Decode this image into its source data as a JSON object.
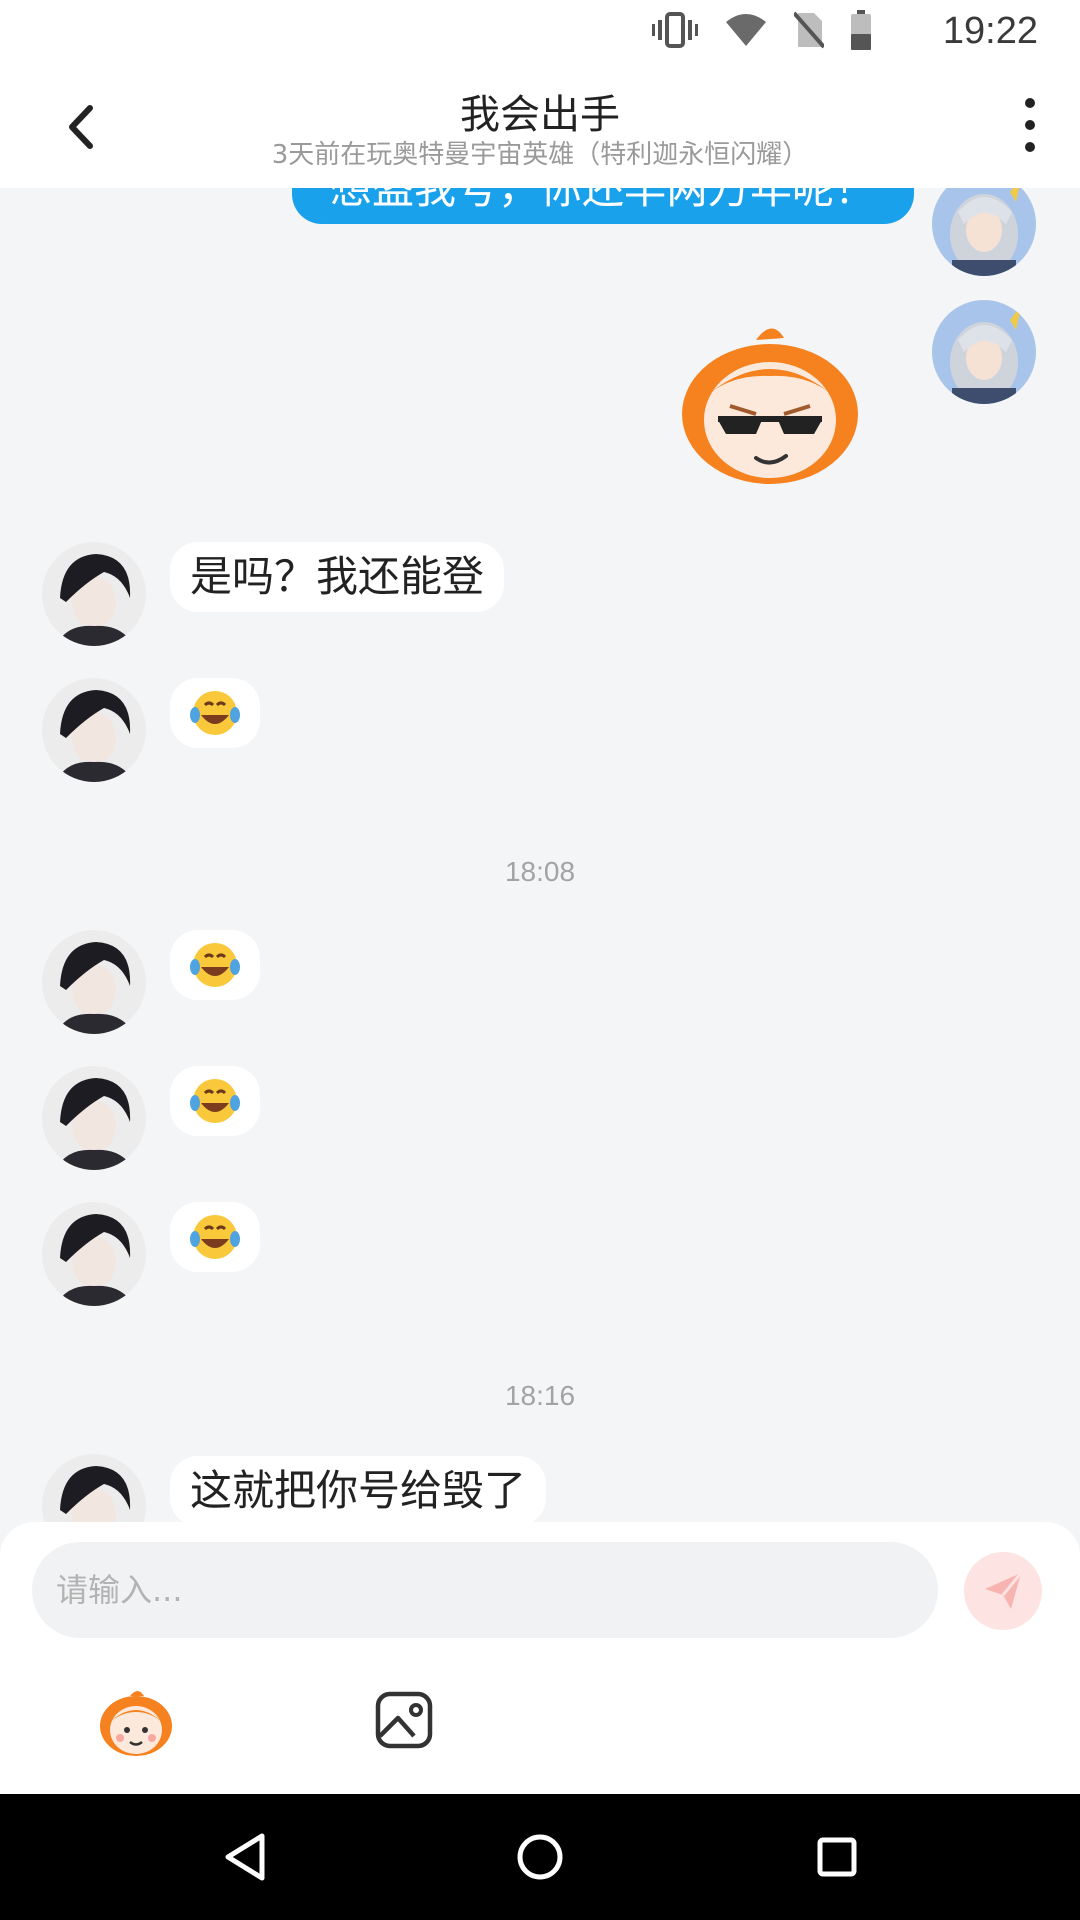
{
  "status_bar": {
    "time": "19:22",
    "icons": [
      "vibrate-icon",
      "wifi-icon",
      "no-sim-icon",
      "battery-icon"
    ]
  },
  "header": {
    "title": "我会出手",
    "subtitle": "3天前在玩奥特曼宇宙英雄（特利迦永恒闪耀）",
    "back_icon": "back-arrow-icon",
    "menu_icon": "more-vertical-icon"
  },
  "messages": [
    {
      "side": "right",
      "type": "text",
      "text": "想盗我号，你还早两万年呢！"
    },
    {
      "side": "right",
      "type": "sticker",
      "sticker": "sunglasses-mascot-sticker"
    },
    {
      "side": "left",
      "type": "text",
      "text": "是吗？我还能登"
    },
    {
      "side": "left",
      "type": "emoji",
      "emoji": "😂"
    },
    {
      "side": "center",
      "type": "timestamp",
      "text": "18:08"
    },
    {
      "side": "left",
      "type": "emoji",
      "emoji": "😂"
    },
    {
      "side": "left",
      "type": "emoji",
      "emoji": "😂"
    },
    {
      "side": "left",
      "type": "emoji",
      "emoji": "😂"
    },
    {
      "side": "center",
      "type": "timestamp",
      "text": "18:16"
    },
    {
      "side": "left",
      "type": "text",
      "text": "这就把你号给毁了"
    }
  ],
  "composer": {
    "placeholder": "请输入...",
    "send_icon": "send-icon",
    "tools": [
      "sticker-mascot-icon",
      "image-icon"
    ]
  },
  "nav_bar": [
    "back-triangle-icon",
    "home-circle-icon",
    "recents-square-icon"
  ],
  "colors": {
    "accent": "#1aa1ec",
    "background": "#f4f5f7",
    "send_disabled": "#fde3e2",
    "send_arrow": "#f08a86",
    "mascot_orange": "#f5821f"
  }
}
